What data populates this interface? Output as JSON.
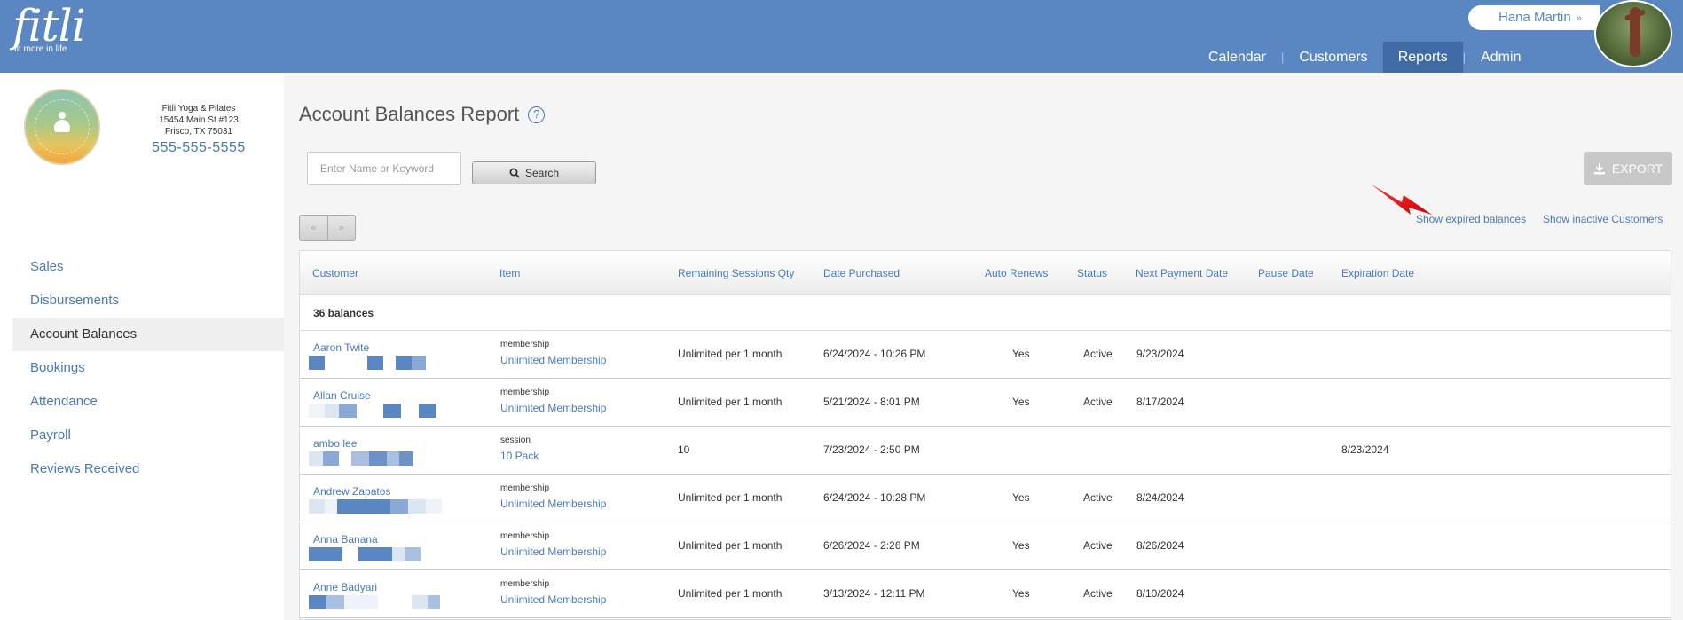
{
  "header": {
    "logo_word": "fitli",
    "logo_tagline": "fit more in life",
    "user_name": "Hana Martin",
    "user_chevron_icon": "double-chevron-down-icon",
    "nav": [
      {
        "label": "Calendar",
        "active": false
      },
      {
        "label": "Customers",
        "active": false
      },
      {
        "label": "Reports",
        "active": true
      },
      {
        "label": "Admin",
        "active": false
      }
    ],
    "nav_separator": "|"
  },
  "sidebar": {
    "studio": {
      "name": "Fitli Yoga & Pilates",
      "address1": "15454 Main St #123",
      "address2": "Frisco, TX 75031",
      "phone": "555-555-5555"
    },
    "menu": [
      {
        "label": "Sales",
        "active": false
      },
      {
        "label": "Disbursements",
        "active": false
      },
      {
        "label": "Account Balances",
        "active": true
      },
      {
        "label": "Bookings",
        "active": false
      },
      {
        "label": "Attendance",
        "active": false
      },
      {
        "label": "Payroll",
        "active": false
      },
      {
        "label": "Reviews Received",
        "active": false
      }
    ]
  },
  "main": {
    "title": "Account Balances Report",
    "help_icon": "question-circle-icon",
    "search": {
      "placeholder": "Enter Name or Keyword",
      "value": "",
      "button_label": "Search",
      "icon": "magnifier-icon"
    },
    "export_label": "EXPORT",
    "export_icon": "download-icon",
    "pager": {
      "prev": "«",
      "next": "»"
    },
    "links": {
      "expired": "Show expired balances",
      "inactive": "Show inactive Customers"
    },
    "accent_color": "#4a7ab7",
    "header_color": "#5a86c2"
  },
  "table": {
    "columns": [
      "Customer",
      "Item",
      "Remaining Sessions Qty",
      "Date Purchased",
      "Auto Renews",
      "Status",
      "Next Payment Date",
      "Pause Date",
      "Expiration Date"
    ],
    "count_label": "36 balances",
    "rows": [
      {
        "customer": "Aaron Twite",
        "item_type": "membership",
        "item": "Unlimited Membership",
        "remaining": "Unlimited per 1 month",
        "purchased": "6/24/2024 - 10:26 PM",
        "auto_renews": "Yes",
        "status": "Active",
        "next_payment": "9/23/2024",
        "pause": "",
        "expiration": ""
      },
      {
        "customer": "Allan Cruise",
        "item_type": "membership",
        "item": "Unlimited Membership",
        "remaining": "Unlimited per 1 month",
        "purchased": "5/21/2024 - 8:01 PM",
        "auto_renews": "Yes",
        "status": "Active",
        "next_payment": "8/17/2024",
        "pause": "",
        "expiration": ""
      },
      {
        "customer": "ambo lee",
        "item_type": "session",
        "item": "10 Pack",
        "remaining": "10",
        "purchased": "7/23/2024 - 2:50 PM",
        "auto_renews": "",
        "status": "",
        "next_payment": "",
        "pause": "",
        "expiration": "8/23/2024"
      },
      {
        "customer": "Andrew Zapatos",
        "item_type": "membership",
        "item": "Unlimited Membership",
        "remaining": "Unlimited per 1 month",
        "purchased": "6/24/2024 - 10:28 PM",
        "auto_renews": "Yes",
        "status": "Active",
        "next_payment": "8/24/2024",
        "pause": "",
        "expiration": ""
      },
      {
        "customer": "Anna Banana",
        "item_type": "membership",
        "item": "Unlimited Membership",
        "remaining": "Unlimited per 1 month",
        "purchased": "6/26/2024 - 2:26 PM",
        "auto_renews": "Yes",
        "status": "Active",
        "next_payment": "8/26/2024",
        "pause": "",
        "expiration": ""
      },
      {
        "customer": "Anne Badyari",
        "item_type": "membership",
        "item": "Unlimited Membership",
        "remaining": "Unlimited per 1 month",
        "purchased": "3/13/2024 - 12:11 PM",
        "auto_renews": "Yes",
        "status": "Active",
        "next_payment": "8/10/2024",
        "pause": "",
        "expiration": ""
      }
    ]
  }
}
